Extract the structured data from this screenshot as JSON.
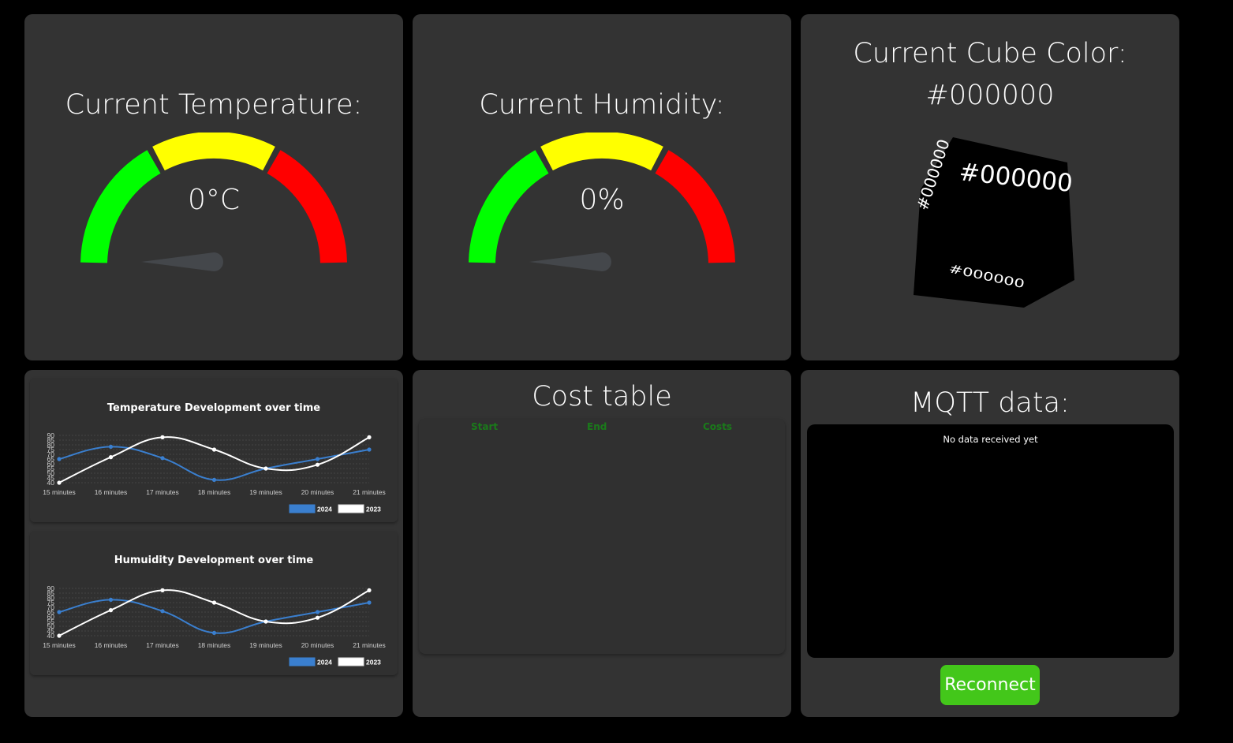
{
  "temperature": {
    "title": "Current Temperature:",
    "value": "0°C",
    "level": 0
  },
  "humidity": {
    "title": "Current Humidity:",
    "value": "0%",
    "level": 0
  },
  "cube": {
    "title": "Current Cube Color:",
    "color": "#000000",
    "face_label": "#000000"
  },
  "gauge_colors": {
    "low": "#00ff00",
    "mid": "#ffff00",
    "high": "#ff0000",
    "needle": "#44474b"
  },
  "temp_chart": {
    "title": "Temperature Development over time"
  },
  "humidity_chart": {
    "title": "Humuidity Development over time"
  },
  "chart_data": [
    {
      "type": "line",
      "title": "Temperature Development over time",
      "categories": [
        "15 minutes",
        "16 minutes",
        "17 minutes",
        "18 minutes",
        "19 minutes",
        "20 minutes",
        "21 minutes"
      ],
      "yticks": [
        40,
        45,
        50,
        55,
        60,
        65,
        70,
        75,
        80,
        85,
        90
      ],
      "ylim": [
        40,
        90
      ],
      "series": [
        {
          "name": "2024",
          "color": "#3a7fcf",
          "values": [
            65,
            78,
            66,
            43,
            55,
            65,
            75
          ]
        },
        {
          "name": "2023",
          "color": "#ffffff",
          "values": [
            40,
            67,
            88,
            75,
            55,
            59,
            88
          ]
        }
      ],
      "legend": "bottom-right"
    },
    {
      "type": "line",
      "title": "Humuidity Development over time",
      "categories": [
        "15 minutes",
        "16 minutes",
        "17 minutes",
        "18 minutes",
        "19 minutes",
        "20 minutes",
        "21 minutes"
      ],
      "yticks": [
        40,
        45,
        50,
        55,
        60,
        65,
        70,
        75,
        80,
        85,
        90
      ],
      "ylim": [
        40,
        90
      ],
      "series": [
        {
          "name": "2024",
          "color": "#3a7fcf",
          "values": [
            65,
            78,
            66,
            43,
            55,
            65,
            75
          ]
        },
        {
          "name": "2023",
          "color": "#ffffff",
          "values": [
            40,
            67,
            88,
            75,
            55,
            59,
            88
          ]
        }
      ],
      "legend": "bottom-right"
    }
  ],
  "cost_table": {
    "title": "Cost table",
    "headers": [
      "Start",
      "End",
      "Costs"
    ],
    "rows": []
  },
  "mqtt": {
    "title": "MQTT data:",
    "message": "No data received yet",
    "reconnect_label": "Reconnect"
  }
}
